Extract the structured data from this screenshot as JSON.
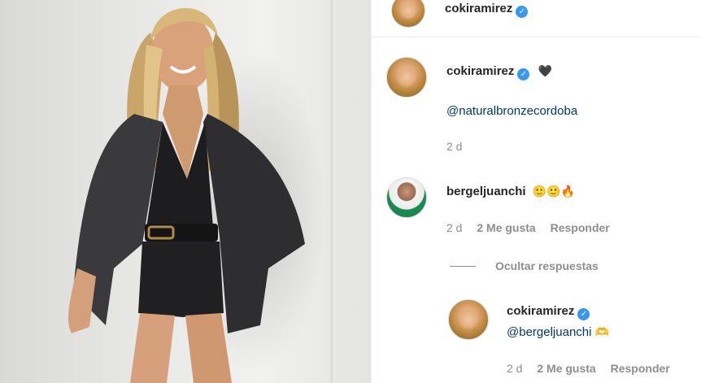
{
  "post": {
    "author": "cokiramirez"
  },
  "icons": {
    "verified": "verified-badge-icon"
  },
  "comments": [
    {
      "username": "cokiramirez",
      "text_suffix": "🖤",
      "body": "@naturalbronzecordoba",
      "age": "2 d"
    },
    {
      "username": "bergeljuanchi",
      "text_suffix": "🙂🙂🔥",
      "age": "2 d",
      "likes": "2 Me gusta",
      "reply_label": "Responder",
      "toggle_replies": "Ocultar respuestas",
      "replies": [
        {
          "username": "cokiramirez",
          "body": "@bergeljuanchi",
          "body_suffix": "🫶",
          "age": "2 d",
          "likes": "2 Me gusta",
          "reply_label": "Responder"
        }
      ]
    }
  ]
}
